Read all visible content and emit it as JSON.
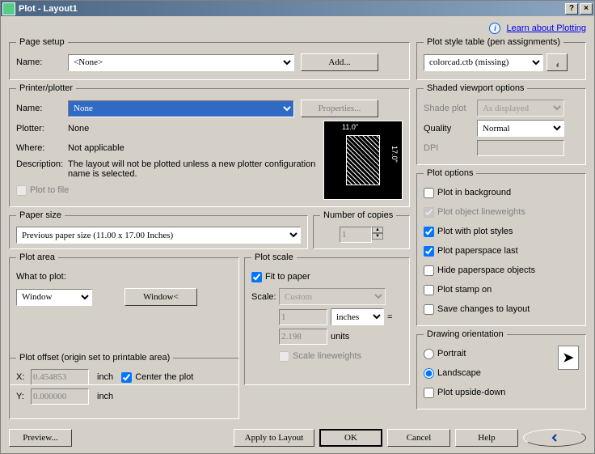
{
  "window": {
    "title": "Plot - Layout1"
  },
  "link": {
    "learn": "Learn about Plotting"
  },
  "pageSetup": {
    "legend": "Page setup",
    "nameLabel": "Name:",
    "name": "<None>",
    "add": "Add..."
  },
  "printer": {
    "legend": "Printer/plotter",
    "nameLabel": "Name:",
    "name": "None",
    "properties": "Properties...",
    "plotterLabel": "Plotter:",
    "plotter": "None",
    "whereLabel": "Where:",
    "where": "Not applicable",
    "descLabel": "Description:",
    "desc": "The layout will not be plotted unless a new plotter configuration name is selected.",
    "plotToFile": "Plot to file",
    "dimW": "11.0\"",
    "dimH": "17.0\""
  },
  "paper": {
    "legend": "Paper size",
    "value": "Previous paper size (11.00 x 17.00 Inches)"
  },
  "copies": {
    "legend": "Number of copies",
    "value": "1"
  },
  "plotArea": {
    "legend": "Plot area",
    "whatLabel": "What to plot:",
    "what": "Window",
    "windowBtn": "Window<"
  },
  "plotScale": {
    "legend": "Plot scale",
    "fit": "Fit to paper",
    "scaleLabel": "Scale:",
    "scale": "Custom",
    "val1": "1",
    "unit1": "inches",
    "eq": "=",
    "val2": "2.198",
    "unit2": "units",
    "scaleLw": "Scale lineweights"
  },
  "offset": {
    "legend": "Plot offset (origin set to printable area)",
    "xLabel": "X:",
    "x": "0.454853",
    "yLabel": "Y:",
    "y": "0.000000",
    "inch": "inch",
    "center": "Center the plot"
  },
  "styleTable": {
    "legend": "Plot style table (pen assignments)",
    "value": "colorcad.ctb (missing)"
  },
  "shaded": {
    "legend": "Shaded viewport options",
    "shadeLabel": "Shade plot",
    "shade": "As displayed",
    "qualityLabel": "Quality",
    "quality": "Normal",
    "dpiLabel": "DPI",
    "dpi": ""
  },
  "options": {
    "legend": "Plot options",
    "bg": "Plot in background",
    "lw": "Plot object lineweights",
    "styles": "Plot with plot styles",
    "pslast": "Plot paperspace last",
    "hidePs": "Hide paperspace objects",
    "stamp": "Plot stamp on",
    "save": "Save changes to layout"
  },
  "orient": {
    "legend": "Drawing orientation",
    "portrait": "Portrait",
    "landscape": "Landscape",
    "upside": "Plot upside-down"
  },
  "buttons": {
    "preview": "Preview...",
    "apply": "Apply to Layout",
    "ok": "OK",
    "cancel": "Cancel",
    "help": "Help"
  }
}
